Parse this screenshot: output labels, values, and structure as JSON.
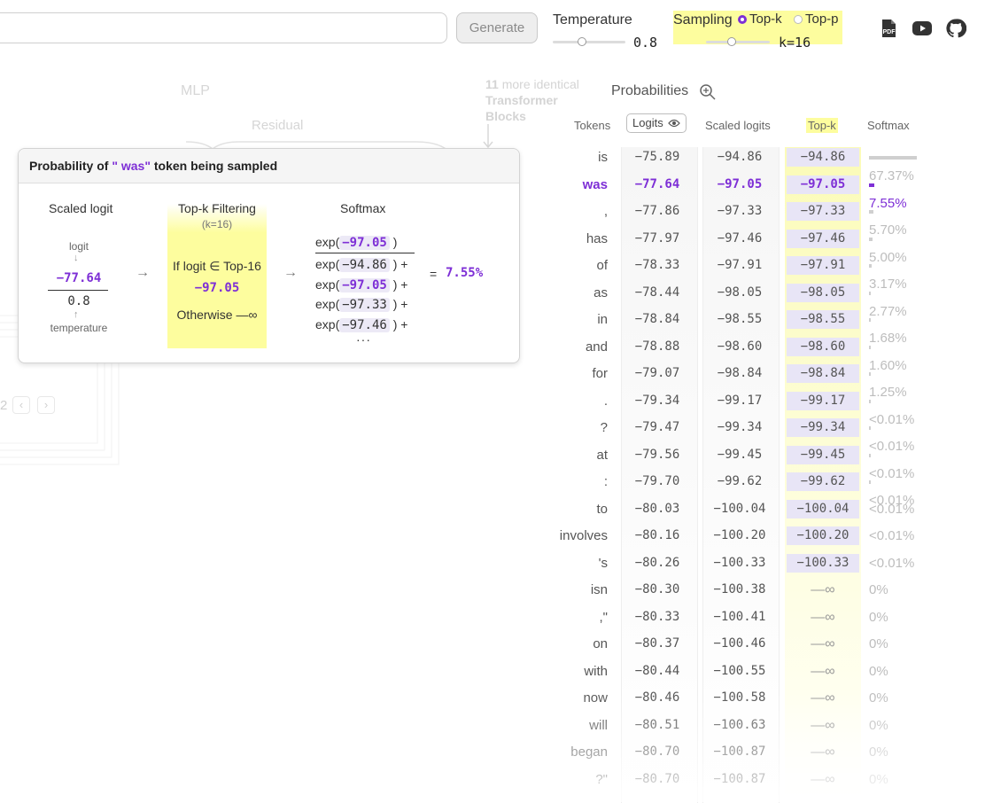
{
  "toolbar": {
    "prompt_value": "",
    "generate_label": "Generate",
    "temperature_label": "Temperature",
    "temperature_value": "0.8",
    "temperature_level": 0.4,
    "sampling_label": "Sampling",
    "topk_option": "Top-k",
    "topp_option": "Top-p",
    "selected_option": "Top-k",
    "k_value": "k=16",
    "k_level": 0.4,
    "icons": [
      "pdf-icon",
      "youtube-icon",
      "github-icon"
    ]
  },
  "diagram": {
    "mlp_label": "MLP",
    "residual_label": "Residual",
    "more_blocks_count": "11",
    "more_blocks_text": "more identical",
    "more_blocks_text2": "Transformer",
    "more_blocks_text3": "Blocks",
    "page_number": "2"
  },
  "probabilities": {
    "title": "Probabilities",
    "headers": {
      "tokens": "Tokens",
      "logits": "Logits",
      "scaled": "Scaled logits",
      "topk": "Top-k",
      "softmax": "Softmax"
    },
    "rows": [
      {
        "token": "is",
        "logit": "−75.89",
        "scaled": "−94.86",
        "topk": "−94.86",
        "softmax": "67.37%",
        "p": 67.37
      },
      {
        "token": "was",
        "logit": "−77.64",
        "scaled": "−97.05",
        "topk": "−97.05",
        "softmax": "7.55%",
        "p": 7.55,
        "selected": true
      },
      {
        "token": ",",
        "logit": "−77.86",
        "scaled": "−97.33",
        "topk": "−97.33",
        "softmax": "5.70%",
        "p": 5.7
      },
      {
        "token": "has",
        "logit": "−77.97",
        "scaled": "−97.46",
        "topk": "−97.46",
        "softmax": "5.00%",
        "p": 5.0
      },
      {
        "token": "of",
        "logit": "−78.33",
        "scaled": "−97.91",
        "topk": "−97.91",
        "softmax": "3.17%",
        "p": 3.17
      },
      {
        "token": "as",
        "logit": "−78.44",
        "scaled": "−98.05",
        "topk": "−98.05",
        "softmax": "2.77%",
        "p": 2.77
      },
      {
        "token": "in",
        "logit": "−78.84",
        "scaled": "−98.55",
        "topk": "−98.55",
        "softmax": "1.68%",
        "p": 1.68
      },
      {
        "token": "and",
        "logit": "−78.88",
        "scaled": "−98.60",
        "topk": "−98.60",
        "softmax": "1.60%",
        "p": 1.6
      },
      {
        "token": "for",
        "logit": "−79.07",
        "scaled": "−98.84",
        "topk": "−98.84",
        "softmax": "1.25%",
        "p": 1.25
      },
      {
        "token": ".",
        "logit": "−79.34",
        "scaled": "−99.17",
        "topk": "−99.17",
        "softmax": "<0.01%",
        "p": 0.5
      },
      {
        "token": "?",
        "logit": "−79.47",
        "scaled": "−99.34",
        "topk": "−99.34",
        "softmax": "<0.01%",
        "p": 0.5
      },
      {
        "token": "at",
        "logit": "−79.56",
        "scaled": "−99.45",
        "topk": "−99.45",
        "softmax": "<0.01%",
        "p": 0.5
      },
      {
        "token": ":",
        "logit": "−79.70",
        "scaled": "−99.62",
        "topk": "−99.62",
        "softmax": "<0.01%",
        "p": 0.5
      },
      {
        "token": "to",
        "logit": "−80.03",
        "scaled": "−100.04",
        "topk": "−100.04",
        "softmax": "<0.01%",
        "p": 0
      },
      {
        "token": "involves",
        "logit": "−80.16",
        "scaled": "−100.20",
        "topk": "−100.20",
        "softmax": "<0.01%",
        "p": 0
      },
      {
        "token": "'s",
        "logit": "−80.26",
        "scaled": "−100.33",
        "topk": "−100.33",
        "softmax": "<0.01%",
        "p": 0
      },
      {
        "token": "isn",
        "logit": "−80.30",
        "scaled": "−100.38",
        "topk": "—∞",
        "softmax": "0%",
        "p": 0
      },
      {
        "token": ",\"",
        "logit": "−80.33",
        "scaled": "−100.41",
        "topk": "—∞",
        "softmax": "0%",
        "p": 0
      },
      {
        "token": "on",
        "logit": "−80.37",
        "scaled": "−100.46",
        "topk": "—∞",
        "softmax": "0%",
        "p": 0
      },
      {
        "token": "with",
        "logit": "−80.44",
        "scaled": "−100.55",
        "topk": "—∞",
        "softmax": "0%",
        "p": 0
      },
      {
        "token": "now",
        "logit": "−80.46",
        "scaled": "−100.58",
        "topk": "—∞",
        "softmax": "0%",
        "p": 0
      },
      {
        "token": "will",
        "logit": "−80.51",
        "scaled": "−100.63",
        "topk": "—∞",
        "softmax": "0%",
        "p": 0
      },
      {
        "token": "began",
        "logit": "−80.70",
        "scaled": "−100.87",
        "topk": "—∞",
        "softmax": "0%",
        "p": 0
      },
      {
        "token": "?\"",
        "logit": "−80.70",
        "scaled": "−100.87",
        "topk": "—∞",
        "softmax": "0%",
        "p": 0
      }
    ]
  },
  "popup": {
    "title_prefix": "Probability of",
    "title_token": "\" was\"",
    "title_suffix": "token being sampled",
    "scaled_logit_title": "Scaled logit",
    "logit_label": "logit",
    "logit_value": "−77.64",
    "temperature_value": "0.8",
    "temperature_label": "temperature",
    "topk_title": "Top-k Filtering",
    "topk_k": "(k=16)",
    "if_text": "If logit ∈ Top-16",
    "scaled_value": "−97.05",
    "otherwise_text": "Otherwise —∞",
    "softmax_title": "Softmax",
    "numerator": "−97.05",
    "denominators": [
      "−94.86",
      "−97.05",
      "−97.33",
      "−97.46"
    ],
    "result": "7.55%",
    "exp_label": "exp(",
    "plus": "+",
    "equals": "="
  }
}
